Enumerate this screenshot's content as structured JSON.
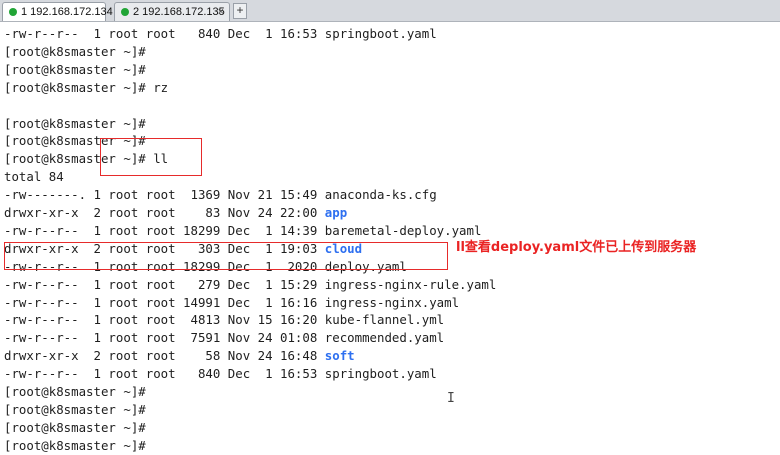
{
  "tabs": [
    {
      "label": "1 192.168.172.134",
      "active": true
    },
    {
      "label": "2 192.168.172.135",
      "active": false
    }
  ],
  "add_tab_label": "+",
  "close_tab_label": "×",
  "terminal_lines": [
    {
      "segments": [
        {
          "text": "-rw-r--r--  1 root root   840 Dec  1 16:53 springboot.yaml"
        }
      ]
    },
    {
      "segments": [
        {
          "text": "[root@k8smaster ~]#"
        }
      ]
    },
    {
      "segments": [
        {
          "text": "[root@k8smaster ~]#"
        }
      ]
    },
    {
      "segments": [
        {
          "text": "[root@k8smaster ~]# rz"
        }
      ]
    },
    {
      "segments": [
        {
          "text": ""
        }
      ]
    },
    {
      "segments": [
        {
          "text": "[root@k8smaster ~]#"
        }
      ]
    },
    {
      "segments": [
        {
          "text": "[root@k8smaster ~]#"
        }
      ]
    },
    {
      "segments": [
        {
          "text": "[root@k8smaster ~]# ll"
        }
      ]
    },
    {
      "segments": [
        {
          "text": "total 84"
        }
      ]
    },
    {
      "segments": [
        {
          "text": "-rw-------. 1 root root  1369 Nov 21 15:49 anaconda-ks.cfg"
        }
      ]
    },
    {
      "segments": [
        {
          "text": "drwxr-xr-x  2 root root    83 Nov 24 22:00 "
        },
        {
          "text": "app",
          "dir": true
        }
      ]
    },
    {
      "segments": [
        {
          "text": "-rw-r--r--  1 root root 18299 Dec  1 14:39 baremetal-deploy.yaml"
        }
      ]
    },
    {
      "segments": [
        {
          "text": "drwxr-xr-x  2 root root   303 Dec  1 19:03 "
        },
        {
          "text": "cloud",
          "dir": true
        }
      ]
    },
    {
      "segments": [
        {
          "text": "-rw-r--r--  1 root root 18299 Dec  1  2020 deploy.yaml"
        }
      ]
    },
    {
      "segments": [
        {
          "text": "-rw-r--r--  1 root root   279 Dec  1 15:29 ingress-nginx-rule.yaml"
        }
      ]
    },
    {
      "segments": [
        {
          "text": "-rw-r--r--  1 root root 14991 Dec  1 16:16 ingress-nginx.yaml"
        }
      ]
    },
    {
      "segments": [
        {
          "text": "-rw-r--r--  1 root root  4813 Nov 15 16:20 kube-flannel.yml"
        }
      ]
    },
    {
      "segments": [
        {
          "text": "-rw-r--r--  1 root root  7591 Nov 24 01:08 recommended.yaml"
        }
      ]
    },
    {
      "segments": [
        {
          "text": "drwxr-xr-x  2 root root    58 Nov 24 16:48 "
        },
        {
          "text": "soft",
          "dir": true
        }
      ]
    },
    {
      "segments": [
        {
          "text": "-rw-r--r--  1 root root   840 Dec  1 16:53 springboot.yaml"
        }
      ]
    },
    {
      "segments": [
        {
          "text": "[root@k8smaster ~]#"
        }
      ]
    },
    {
      "segments": [
        {
          "text": "[root@k8smaster ~]#"
        }
      ]
    },
    {
      "segments": [
        {
          "text": "[root@k8smaster ~]#"
        }
      ]
    },
    {
      "segments": [
        {
          "text": "[root@k8smaster ~]#"
        }
      ]
    }
  ],
  "annotation_text": "ll查看deploy.yaml文件已上传到服务器",
  "mouse_cursor_glyph": "I",
  "colors": {
    "directory": "#2d6ff0",
    "annotation": "#ea2323",
    "active_dot": "#21a536"
  }
}
